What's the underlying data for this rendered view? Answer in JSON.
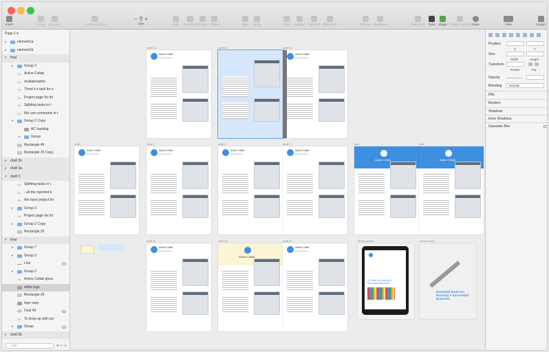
{
  "window": {
    "lights": [
      "#fc605c",
      "#fdbc40",
      "#34c84a"
    ]
  },
  "toolbar": {
    "insert": "Insert",
    "group": "Group",
    "ungroup": "Ungroup",
    "create_symbol": "Create Symbol",
    "zoom": "25%",
    "edit": "Edit",
    "transform": "Transform",
    "rotate": "Rotate",
    "flatten": "Flatten",
    "mask": "Mask",
    "scale": "Scale",
    "union": "Union",
    "subtract": "Subtract",
    "intersect": "Intersect",
    "difference": "Difference",
    "forward": "Forward",
    "backward": "Backward",
    "mirror": "Mirror",
    "cloud": "Cloud",
    "view": "View",
    "export": "Export",
    "make_grid": "Make Grid",
    "tools": "Tools",
    "shape": "Shape",
    "rotate_copies": "Rotate Copies",
    "share": "Share"
  },
  "sidebar": {
    "page_selector": "Page 1 ▾",
    "filter_placeholder": "Filter",
    "filter_count": "⊞ ✎ 14",
    "layers": [
      {
        "label": "element1a",
        "indent": 0,
        "icon": "folder",
        "arrow": "▸",
        "section": false
      },
      {
        "label": "element1b",
        "indent": 0,
        "icon": "folder",
        "arrow": "▸",
        "section": false
      },
      {
        "label": "final",
        "indent": 0,
        "icon": "artboard",
        "arrow": "▾",
        "section": true
      },
      {
        "label": "Group 2",
        "indent": 1,
        "icon": "folder",
        "arrow": "▸",
        "section": false
      },
      {
        "label": "Active Collab",
        "indent": 1,
        "icon": "text",
        "arrow": "",
        "section": false
      },
      {
        "label": "#collaboration",
        "indent": 1,
        "icon": "text",
        "arrow": "",
        "section": false
      },
      {
        "label": "There's a task for e",
        "indent": 1,
        "icon": "text",
        "arrow": "",
        "section": false
      },
      {
        "label": "Project page for thi",
        "indent": 1,
        "icon": "text",
        "arrow": "",
        "section": false
      },
      {
        "label": "Splitting tasks in t",
        "indent": 1,
        "icon": "text",
        "arrow": "",
        "section": false
      },
      {
        "label": "We use comments in t",
        "indent": 1,
        "icon": "text",
        "arrow": "",
        "section": false
      },
      {
        "label": "Group 2 Copy",
        "indent": 1,
        "icon": "folder",
        "arrow": "▾",
        "section": false
      },
      {
        "label": "AC backlog",
        "indent": 2,
        "icon": "img",
        "arrow": "",
        "section": false
      },
      {
        "label": "Group",
        "indent": 2,
        "icon": "folder",
        "arrow": "▸",
        "section": false
      },
      {
        "label": "Rectangle 46",
        "indent": 1,
        "icon": "shape",
        "arrow": "",
        "section": false
      },
      {
        "label": "Rectangle 25 Copy",
        "indent": 1,
        "icon": "shape",
        "arrow": "",
        "section": false
      },
      {
        "label": "draft 3b",
        "indent": 0,
        "icon": "artboard",
        "arrow": "▸",
        "section": true
      },
      {
        "label": "draft 3a",
        "indent": 0,
        "icon": "artboard",
        "arrow": "▸",
        "section": true
      },
      {
        "label": "draft 3",
        "indent": 0,
        "icon": "artboard",
        "arrow": "▾",
        "section": true
      },
      {
        "label": "Splitting tasks in t",
        "indent": 1,
        "icon": "text",
        "arrow": "",
        "section": false
      },
      {
        "label": "- all the reported b",
        "indent": 1,
        "icon": "text",
        "arrow": "",
        "section": false
      },
      {
        "label": "We have project for",
        "indent": 1,
        "icon": "text",
        "arrow": "",
        "section": false
      },
      {
        "label": "Group 3",
        "indent": 1,
        "icon": "folder",
        "arrow": "▸",
        "section": false
      },
      {
        "label": "Project page for thi",
        "indent": 1,
        "icon": "text",
        "arrow": "",
        "section": false
      },
      {
        "label": "Group 2 Copy",
        "indent": 1,
        "icon": "folder",
        "arrow": "▸",
        "section": false
      },
      {
        "label": "Rectangle 25",
        "indent": 1,
        "icon": "shape",
        "arrow": "",
        "section": false
      },
      {
        "label": "final",
        "indent": 0,
        "icon": "artboard",
        "arrow": "▾",
        "section": true
      },
      {
        "label": "Group 7",
        "indent": 1,
        "icon": "folder",
        "arrow": "▸",
        "section": false
      },
      {
        "label": "Group 3",
        "indent": 1,
        "icon": "folder",
        "arrow": "▸",
        "section": false
      },
      {
        "label": "Line",
        "indent": 1,
        "icon": "line",
        "arrow": "",
        "section": false,
        "eye": true
      },
      {
        "label": "Group 2",
        "indent": 1,
        "icon": "folder",
        "arrow": "▸",
        "section": false
      },
      {
        "label": "Active Collab gives",
        "indent": 1,
        "icon": "text",
        "arrow": "",
        "section": false
      },
      {
        "label": "white logo",
        "indent": 1,
        "icon": "img",
        "arrow": "",
        "section": false
      },
      {
        "label": "Rectangle 26",
        "indent": 1,
        "icon": "shape",
        "arrow": "",
        "section": false
      },
      {
        "label": "logo copy",
        "indent": 1,
        "icon": "img",
        "arrow": "",
        "section": false
      },
      {
        "label": "Oval 40",
        "indent": 1,
        "icon": "oval",
        "arrow": "",
        "section": false,
        "eye": true
      },
      {
        "label": "To keep up with our",
        "indent": 1,
        "icon": "text",
        "arrow": "",
        "section": false
      },
      {
        "label": "Group",
        "indent": 1,
        "icon": "folder",
        "arrow": "▸",
        "section": false,
        "eye": true
      },
      {
        "label": "draft 3b",
        "indent": 0,
        "icon": "artboard",
        "arrow": "▸",
        "section": true
      }
    ]
  },
  "canvas": {
    "artboards": [
      {
        "label": "draft 2a",
        "kind": "doc"
      },
      {
        "label": "draft 3a",
        "kind": "selected"
      },
      {
        "label": "draft 3a",
        "kind": "doc-sidebar"
      },
      {
        "label": "draft 1",
        "kind": "doc"
      },
      {
        "label": "draft 2",
        "kind": "doc"
      },
      {
        "label": "draft 3",
        "kind": "doc"
      },
      {
        "label": "draft 3",
        "kind": "doc"
      },
      {
        "label": "final",
        "kind": "blue-header"
      },
      {
        "label": "final",
        "kind": "blue-header"
      },
      {
        "label": "draft 2b",
        "kind": "doc"
      },
      {
        "label": "draft 3b",
        "kind": "yellow-header"
      },
      {
        "label": "draft 3b",
        "kind": "doc"
      },
      {
        "label": "ebook promo",
        "kind": "tablet"
      },
      {
        "label": "ebook cover",
        "kind": "cover"
      }
    ],
    "brand": "Active Collab",
    "tagline": "#collaboration",
    "tablet_title": "10 Tools for Running a Successful Business",
    "cover_title": "Essential Tools For Running A Successful Business"
  },
  "inspector": {
    "position": "Position",
    "x": "X",
    "y": "Y",
    "size": "Size",
    "width": "Width",
    "height": "Height",
    "transform": "Transform",
    "rotate": "Rotate",
    "flip": "Flip",
    "opacity": "Opacity",
    "blending": "Blending",
    "blending_value": "Normal",
    "sections": [
      "Fills",
      "Borders",
      "Shadows",
      "Inner Shadows",
      "Gaussian Blur"
    ]
  },
  "colors": {
    "accent": "#3d8fe0",
    "selection": "#d6e6fb",
    "folder": "#79aee8"
  }
}
